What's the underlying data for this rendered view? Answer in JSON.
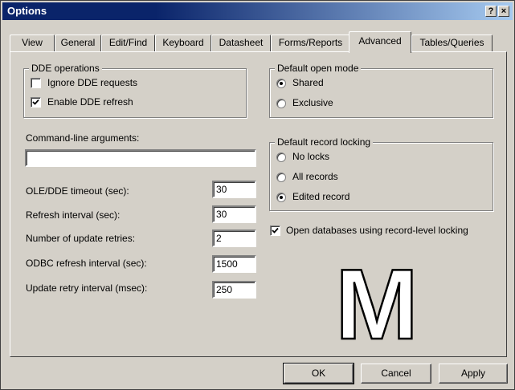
{
  "window": {
    "title": "Options",
    "help_glyph": "?",
    "close_glyph": "×"
  },
  "tabs": [
    {
      "label": "View"
    },
    {
      "label": "General"
    },
    {
      "label": "Edit/Find"
    },
    {
      "label": "Keyboard"
    },
    {
      "label": "Datasheet"
    },
    {
      "label": "Forms/Reports"
    },
    {
      "label": "Advanced",
      "active": true
    },
    {
      "label": "Tables/Queries"
    }
  ],
  "dde": {
    "legend": "DDE operations",
    "ignore": {
      "label": "Ignore DDE requests",
      "checked": false
    },
    "refresh": {
      "label": "Enable DDE refresh",
      "checked": true
    }
  },
  "cmdline": {
    "label": "Command-line arguments:",
    "value": ""
  },
  "fields": [
    {
      "label": "OLE/DDE timeout (sec):",
      "value": "30"
    },
    {
      "label": "Refresh interval (sec):",
      "value": "30"
    },
    {
      "label": "Number of update retries:",
      "value": "2"
    },
    {
      "label": "ODBC refresh interval (sec):",
      "value": "1500"
    },
    {
      "label": "Update retry interval (msec):",
      "value": "250"
    }
  ],
  "open_mode": {
    "legend": "Default open mode",
    "options": [
      {
        "label": "Shared",
        "selected": true
      },
      {
        "label": "Exclusive",
        "selected": false
      }
    ]
  },
  "record_locking": {
    "legend": "Default record locking",
    "options": [
      {
        "label": "No locks",
        "selected": false
      },
      {
        "label": "All records",
        "selected": false
      },
      {
        "label": "Edited record",
        "selected": true
      }
    ]
  },
  "record_level_locking": {
    "label": "Open databases using record-level locking",
    "checked": true
  },
  "watermark": "M",
  "buttons": {
    "ok": "OK",
    "cancel": "Cancel",
    "apply": "Apply"
  }
}
